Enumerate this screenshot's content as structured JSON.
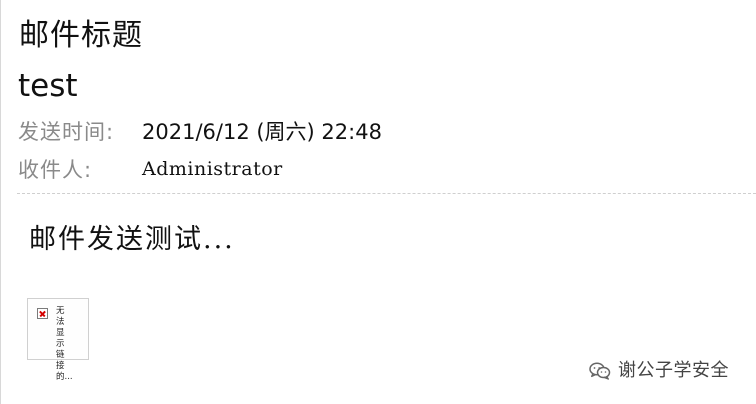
{
  "email": {
    "title_label": "邮件标题",
    "subject": "test",
    "sent_label": "发送时间:",
    "sent_value": "2021/6/12 (周六) 22:48",
    "to_label": "收件人:",
    "to_value": "Administrator",
    "body_text": "邮件发送测试..."
  },
  "image_placeholder": {
    "alt_text": "无法显示链接的..."
  },
  "watermark": {
    "text": "谢公子学安全",
    "icon": "wechat-icon"
  },
  "colors": {
    "text": "#111111",
    "muted_label": "#8a8a8a",
    "divider": "#cfcfcf",
    "broken_icon_red": "#d40000"
  }
}
